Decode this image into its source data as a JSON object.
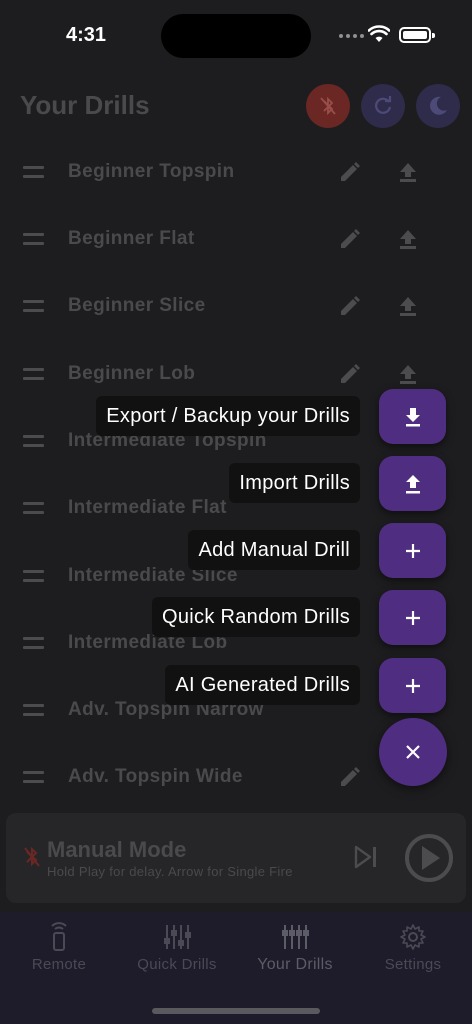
{
  "status_bar": {
    "time": "4:31"
  },
  "header": {
    "title": "Your Drills"
  },
  "drills": [
    {
      "name": "Beginner Topspin"
    },
    {
      "name": "Beginner Flat"
    },
    {
      "name": "Beginner Slice"
    },
    {
      "name": "Beginner Lob"
    },
    {
      "name": "Intermediate Topspin"
    },
    {
      "name": "Intermediate Flat"
    },
    {
      "name": "Intermediate Slice"
    },
    {
      "name": "Intermediate Lob"
    },
    {
      "name": "Adv. Topspin Narrow"
    },
    {
      "name": "Adv. Topspin Wide"
    }
  ],
  "speed_dial": {
    "export_label": "Export / Backup your Drills",
    "import_label": "Import Drills",
    "add_manual_label": "Add Manual Drill",
    "quick_random_label": "Quick Random Drills",
    "ai_generated_label": "AI Generated Drills"
  },
  "manual_mode": {
    "title": "Manual Mode",
    "subtitle": "Hold Play for delay. Arrow for Single Fire"
  },
  "tabs": [
    {
      "label": "Remote"
    },
    {
      "label": "Quick Drills"
    },
    {
      "label": "Your Drills"
    },
    {
      "label": "Settings"
    }
  ],
  "colors": {
    "background": "#1d1d1f",
    "accent_purple": "#4f2e82",
    "bluetooth_off": "#6a2724",
    "dimmed_text": "#4a4a4c"
  }
}
